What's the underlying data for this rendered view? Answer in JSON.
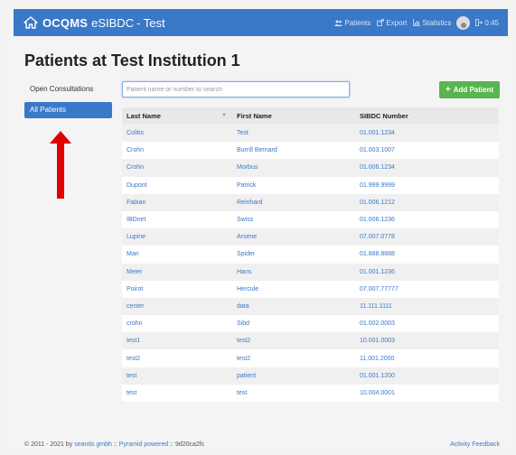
{
  "header": {
    "brand_bold": "OCQMS",
    "brand_light": "eSIBDC",
    "brand_suffix": "- Test",
    "nav": {
      "patients": "Patients",
      "export": "Export",
      "statistics": "Statistics",
      "session_time": "0:45"
    }
  },
  "page": {
    "title": "Patients at Test Institution 1"
  },
  "sidebar": {
    "items": [
      {
        "label": "Open Consultations"
      },
      {
        "label": "All Patients"
      }
    ]
  },
  "search": {
    "placeholder": "Patient name or number to search",
    "value": ""
  },
  "add_patient": {
    "label": "Add Patient"
  },
  "table": {
    "columns": [
      "Last Name",
      "First Name",
      "SIBDC Number"
    ],
    "rows": [
      [
        "Colitis",
        "Test",
        "01.001.1234"
      ],
      [
        "Crohn",
        "Burrill Bernard",
        "01.003.1007"
      ],
      [
        "Crohn",
        "Morbus",
        "01.006.1234"
      ],
      [
        "Dupont",
        "Patrick",
        "01.999.9999"
      ],
      [
        "Fabian",
        "Reinhard",
        "01.006.1212"
      ],
      [
        "IBDnet",
        "Swiss",
        "01.006.1236"
      ],
      [
        "Lupine",
        "Arsene",
        "07.007.0778"
      ],
      [
        "Man",
        "Spider",
        "01.888.8888"
      ],
      [
        "Meier",
        "Hans",
        "01.001.1236"
      ],
      [
        "Poirot",
        "Hercule",
        "07.007.77777"
      ],
      [
        "center",
        "data",
        "11.111.1111"
      ],
      [
        "crohn",
        "Sibd",
        "01.002.0003"
      ],
      [
        "test1",
        "test2",
        "10.001.0003"
      ],
      [
        "test2",
        "test2",
        "11.001.2000"
      ],
      [
        "test",
        "patient",
        "01.001.1200"
      ],
      [
        "test",
        "test",
        "10.004.0001"
      ]
    ]
  },
  "footer": {
    "copyright": "© 2011 - 2021 by",
    "company": "seantis gmbh",
    "separator1": "::",
    "powered": "Pyramid powered",
    "separator2": ":: 9d20ca2fc",
    "feedback": "Activity Feedback"
  },
  "colors": {
    "accent": "#3a78c8",
    "add_button": "#58b54f",
    "annotation_arrow": "#e00000"
  }
}
